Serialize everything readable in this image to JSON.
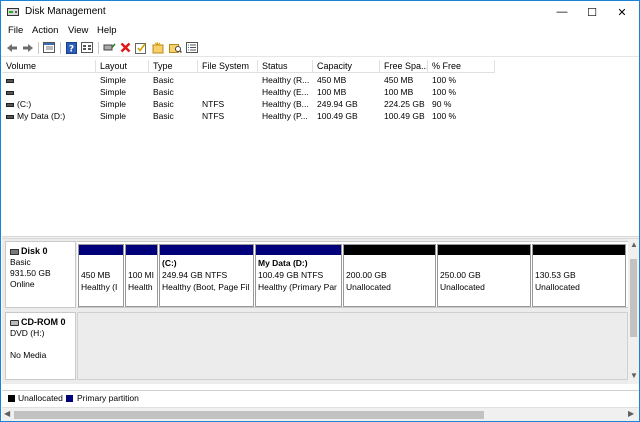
{
  "window": {
    "title": "Disk Management",
    "minimize": "—",
    "maximize": "☐",
    "close": "✕"
  },
  "menu": [
    "File",
    "Action",
    "View",
    "Help"
  ],
  "toolbar": {
    "icons": [
      "back-arrow-icon",
      "forward-arrow-icon",
      "properties-icon",
      "help-icon",
      "settings-icon",
      "connect-icon",
      "delete-icon",
      "check-icon",
      "new-folder-icon",
      "search-folder-icon",
      "list-icon"
    ]
  },
  "volume_list": {
    "columns": [
      "Volume",
      "Layout",
      "Type",
      "File System",
      "Status",
      "Capacity",
      "Free Spa...",
      "% Free"
    ],
    "rows": [
      {
        "volume": "",
        "layout": "Simple",
        "type": "Basic",
        "fs": "",
        "status": "Healthy (R...",
        "capacity": "450 MB",
        "free": "450 MB",
        "pct": "100 %"
      },
      {
        "volume": "",
        "layout": "Simple",
        "type": "Basic",
        "fs": "",
        "status": "Healthy (E...",
        "capacity": "100 MB",
        "free": "100 MB",
        "pct": "100 %"
      },
      {
        "volume": "(C:)",
        "layout": "Simple",
        "type": "Basic",
        "fs": "NTFS",
        "status": "Healthy (B...",
        "capacity": "249.94 GB",
        "free": "224.25 GB",
        "pct": "90 %"
      },
      {
        "volume": "My Data (D:)",
        "layout": "Simple",
        "type": "Basic",
        "fs": "NTFS",
        "status": "Healthy (P...",
        "capacity": "100.49 GB",
        "free": "100.49 GB",
        "pct": "100 %"
      }
    ]
  },
  "disks": [
    {
      "name": "Disk 0",
      "type": "Basic",
      "size": "931.50 GB",
      "state": "Online",
      "partitions": [
        {
          "title": "",
          "line1": "450 MB",
          "line2": "Healthy (I",
          "kind": "primary"
        },
        {
          "title": "",
          "line1": "100 MI",
          "line2": "Health",
          "kind": "primary"
        },
        {
          "title": "(C:)",
          "line1": "249.94 GB NTFS",
          "line2": "Healthy (Boot, Page Fil",
          "kind": "primary"
        },
        {
          "title": "My Data  (D:)",
          "line1": "100.49 GB NTFS",
          "line2": "Healthy (Primary Par",
          "kind": "primary"
        },
        {
          "title": "",
          "line1": "200.00 GB",
          "line2": "Unallocated",
          "kind": "unallocated"
        },
        {
          "title": "",
          "line1": "250.00 GB",
          "line2": "Unallocated",
          "kind": "unallocated"
        },
        {
          "title": "",
          "line1": "130.53 GB",
          "line2": "Unallocated",
          "kind": "unallocated"
        }
      ]
    },
    {
      "name": "CD-ROM 0",
      "type": "DVD (H:)",
      "size": "",
      "state": "No Media"
    }
  ],
  "legend": [
    {
      "label": "Unallocated",
      "color": "#000000"
    },
    {
      "label": "Primary partition",
      "color": "#00007b"
    }
  ],
  "colors": {
    "primary": "#00007b",
    "unallocated": "#000000",
    "window_border": "#1883d7"
  }
}
